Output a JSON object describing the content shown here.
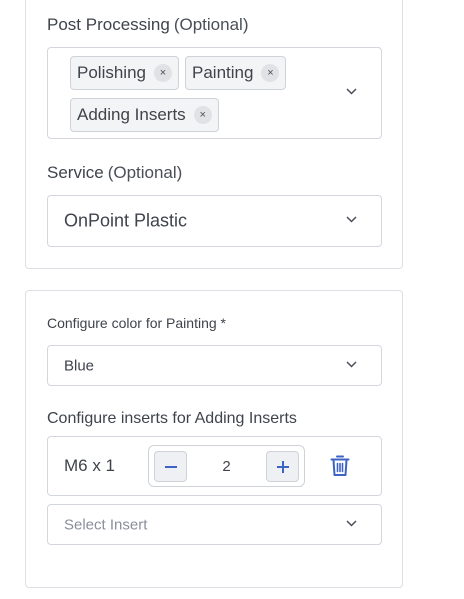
{
  "post_processing": {
    "label": "Post Processing",
    "optional": "(Optional)",
    "chips": [
      {
        "label": "Polishing",
        "remove_icon": "close-icon"
      },
      {
        "label": "Painting",
        "remove_icon": "close-icon"
      },
      {
        "label": "Adding Inserts",
        "remove_icon": "close-icon"
      }
    ],
    "chip_remove_glyph": "×"
  },
  "service": {
    "label": "Service",
    "optional": "(Optional)",
    "value": "OnPoint Plastic"
  },
  "color_config": {
    "label": "Configure color for Painting *",
    "value": "Blue"
  },
  "inserts_config": {
    "label": "Configure inserts for Adding Inserts",
    "rows": [
      {
        "name": "M6 x 1",
        "quantity": "2"
      }
    ],
    "select_placeholder": "Select Insert"
  },
  "colors": {
    "accent": "#3d63c4",
    "border": "#d3d7dd",
    "text": "#3f434b",
    "placeholder": "#8a8f98"
  }
}
